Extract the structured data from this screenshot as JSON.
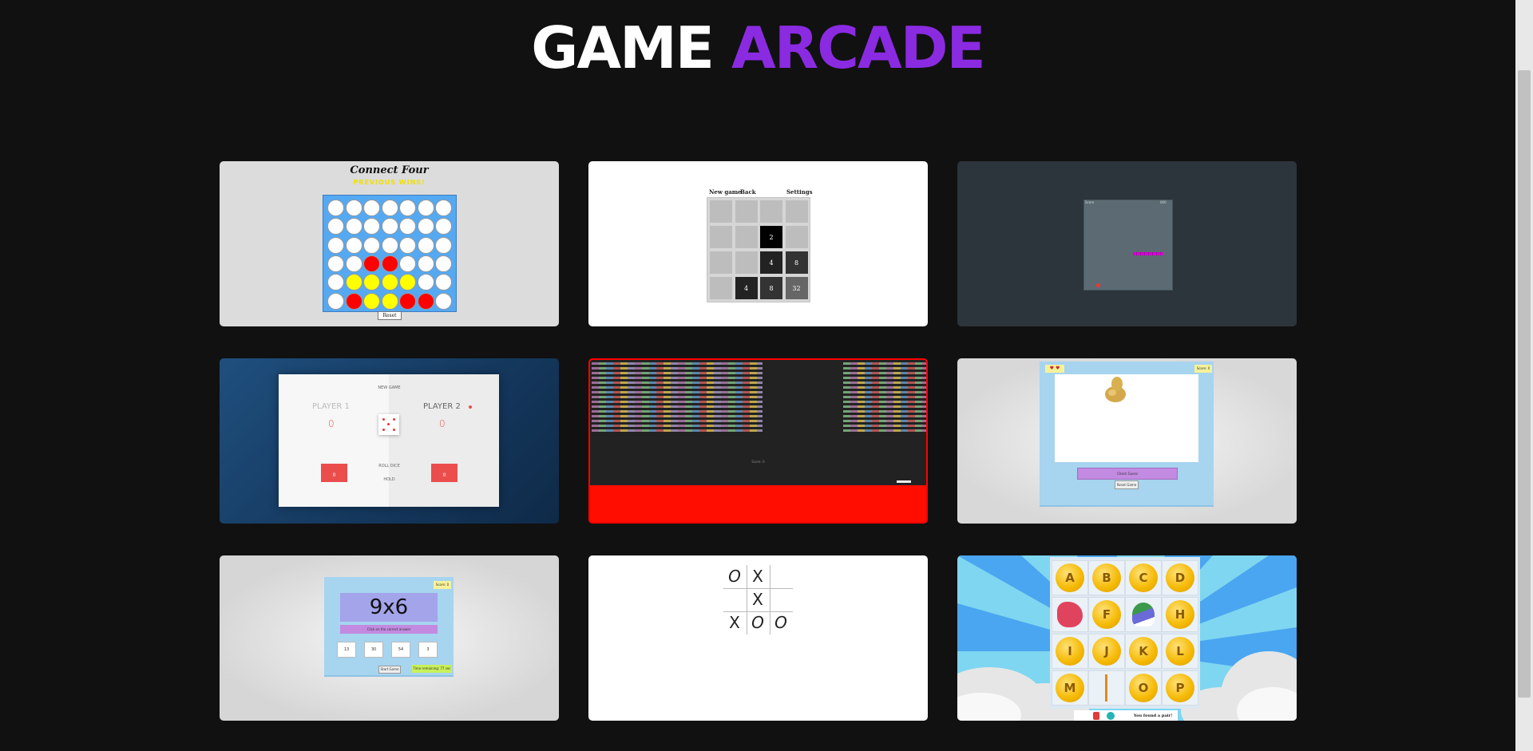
{
  "header": {
    "title_word1": "GAME",
    "title_word2": "ARCADE"
  },
  "colors": {
    "background": "#111111",
    "accent": "#8a2be2"
  },
  "cards": {
    "connect_four": {
      "title": "Connect Four",
      "status": "PREVIOUS WINS!",
      "reset_label": "Reset"
    },
    "game_2048": {
      "new_game": "New game",
      "back": "Back",
      "settings": "Settings",
      "tiles": [
        "",
        "",
        "",
        "",
        "",
        "",
        "2",
        "",
        "",
        "",
        "4",
        "8",
        "",
        "4",
        "8",
        "32"
      ]
    },
    "snake": {
      "score_left": "Score",
      "score_right": "000"
    },
    "pig_dice": {
      "new_game": "NEW GAME",
      "player1": "PLAYER 1",
      "player2": "PLAYER 2",
      "score1": "0",
      "score2": "0",
      "roll": "ROLL DICE",
      "hold": "HOLD",
      "current1": "0",
      "current2": "0"
    },
    "breakout": {
      "status": "Score: 0"
    },
    "fruit_quiz": {
      "lives": "♥ ♥",
      "score": "Score: 0",
      "button1": "Check Guess",
      "button2": "Reset Game"
    },
    "math_quiz": {
      "question": "9x6",
      "score": "Score: 0",
      "instruction": "Click on the correct answer",
      "answers": [
        "13",
        "30",
        "54",
        "3"
      ],
      "start_button": "Start Game",
      "time": "Time remaining: 77 sec"
    },
    "tic_tac_toe": {
      "cells": [
        "O",
        "X",
        "",
        "",
        "X",
        "",
        "X",
        "O",
        "O"
      ]
    },
    "memory": {
      "letters": [
        "A",
        "B",
        "C",
        "D",
        "",
        "F",
        "",
        "H",
        "I",
        "J",
        "K",
        "L",
        "M",
        "",
        "O",
        "P"
      ],
      "found_text": "You found a pair!"
    }
  }
}
